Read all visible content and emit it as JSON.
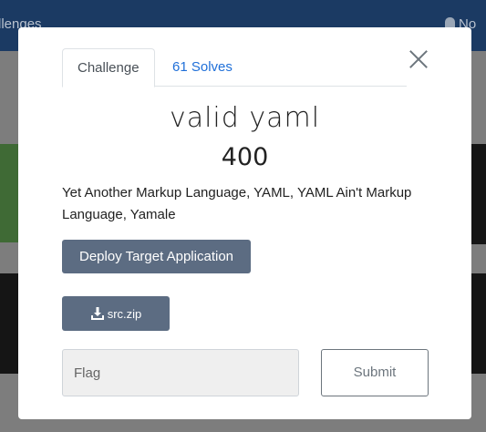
{
  "background": {
    "nav_left_text": "llenges",
    "nav_right_text": "No"
  },
  "modal": {
    "tabs": [
      {
        "label": "Challenge"
      },
      {
        "label": "61 Solves"
      }
    ],
    "challenge_name": "valid yaml",
    "points": "400",
    "description": "Yet Another Markup Language, YAML, YAML Ain't Markup Language, Yamale",
    "deploy_label": "Deploy Target Application",
    "file_label": "src.zip",
    "flag_placeholder": "Flag",
    "submit_label": "Submit"
  }
}
